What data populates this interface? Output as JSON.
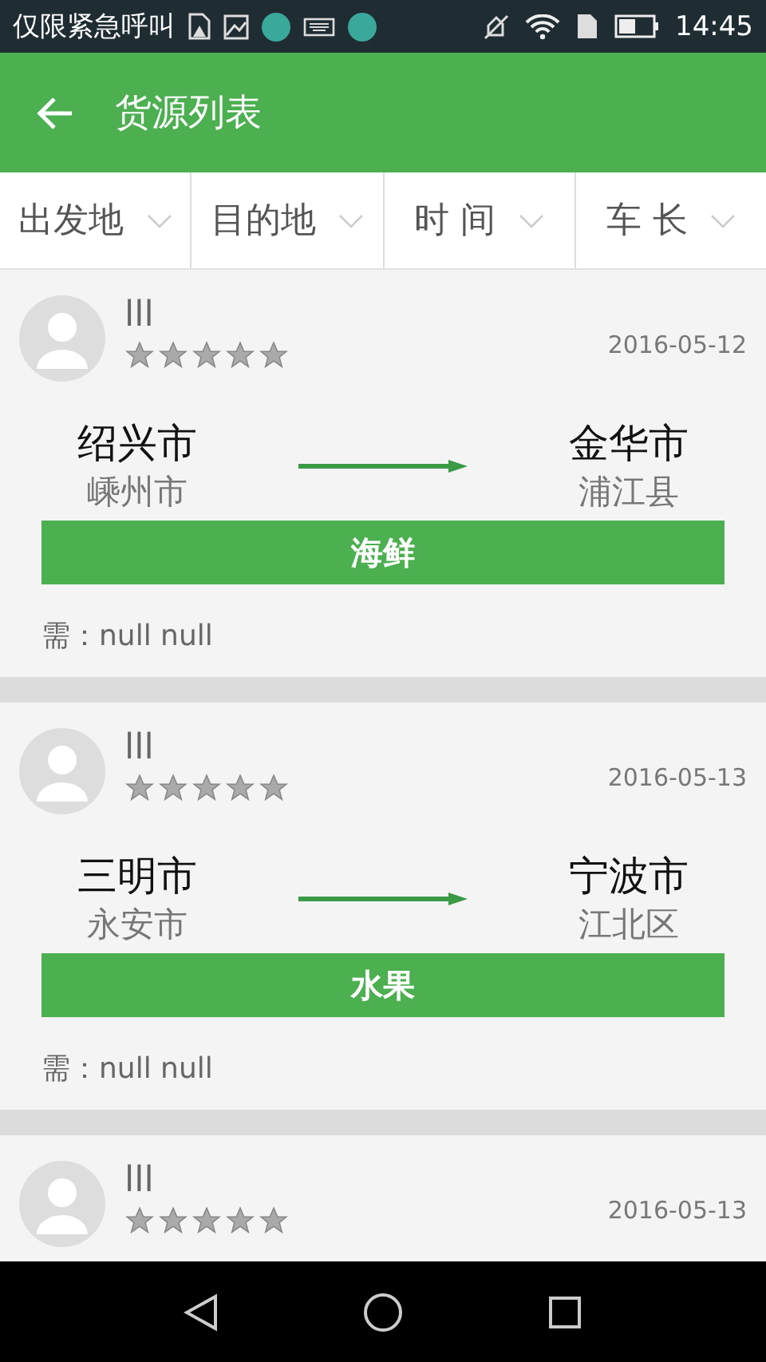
{
  "status_bar": {
    "carrier": "仅限紧急呼叫",
    "time": "14:45"
  },
  "app_bar": {
    "title": "货源列表"
  },
  "filters": [
    {
      "label": "出发地"
    },
    {
      "label": "目的地"
    },
    {
      "label": "时 间"
    },
    {
      "label": "车 长"
    }
  ],
  "cards": [
    {
      "name": "lll",
      "stars": 0,
      "date": "2016-05-12",
      "from_city": "绍兴市",
      "from_district": "嵊州市",
      "to_city": "金华市",
      "to_district": "浦江县",
      "cargo": "海鲜",
      "need": "需：null null"
    },
    {
      "name": "lll",
      "stars": 0,
      "date": "2016-05-13",
      "from_city": "三明市",
      "from_district": "永安市",
      "to_city": "宁波市",
      "to_district": "江北区",
      "cargo": "水果",
      "need": "需：null null"
    },
    {
      "name": "lll",
      "stars": 0,
      "date": "2016-05-13"
    }
  ]
}
